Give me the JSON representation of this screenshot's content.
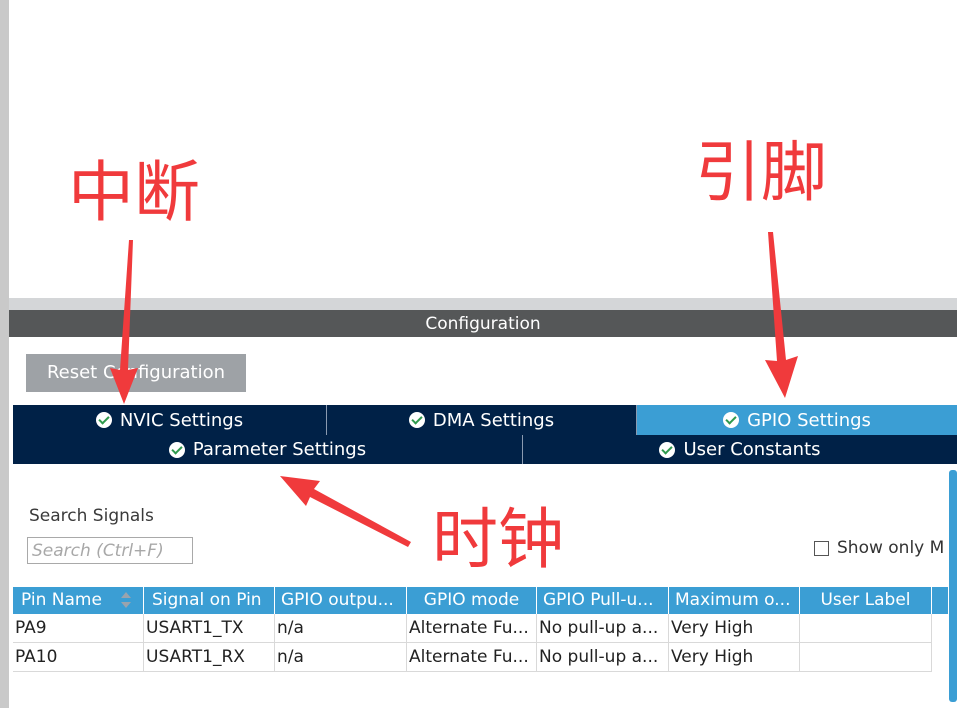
{
  "configuration": {
    "title": "Configuration"
  },
  "toolbar": {
    "reset_label": "Reset Configuration"
  },
  "tabs_row1": [
    {
      "label": "NVIC Settings",
      "active": false
    },
    {
      "label": "DMA Settings",
      "active": false
    },
    {
      "label": "GPIO Settings",
      "active": true
    }
  ],
  "tabs_row2": [
    {
      "label": "Parameter Settings",
      "active": false
    },
    {
      "label": "User Constants",
      "active": false
    }
  ],
  "search": {
    "label": "Search Signals",
    "placeholder": "Search (Ctrl+F)"
  },
  "show_only_label": "Show only M",
  "table": {
    "columns": [
      "Pin Name",
      "Signal on Pin",
      "GPIO outpu...",
      "GPIO mode",
      "GPIO Pull-u...",
      "Maximum o...",
      "User Label"
    ],
    "rows": [
      [
        "PA9",
        "USART1_TX",
        "n/a",
        "Alternate Fu...",
        "No pull-up a...",
        "Very High",
        ""
      ],
      [
        "PA10",
        "USART1_RX",
        "n/a",
        "Alternate Fu...",
        "No pull-up a...",
        "Very High",
        ""
      ]
    ]
  },
  "annotations": {
    "interrupt": "中断",
    "pins": "引脚",
    "clock": "时钟"
  },
  "colors": {
    "tab_dark": "#002147",
    "tab_active": "#3b9ed4",
    "header_blue": "#3b9ed4",
    "annotation_red": "#f03a3c",
    "config_bar": "#555758"
  },
  "icons": {
    "tab_check": "check-circle-icon",
    "sort": "sort-icon"
  }
}
